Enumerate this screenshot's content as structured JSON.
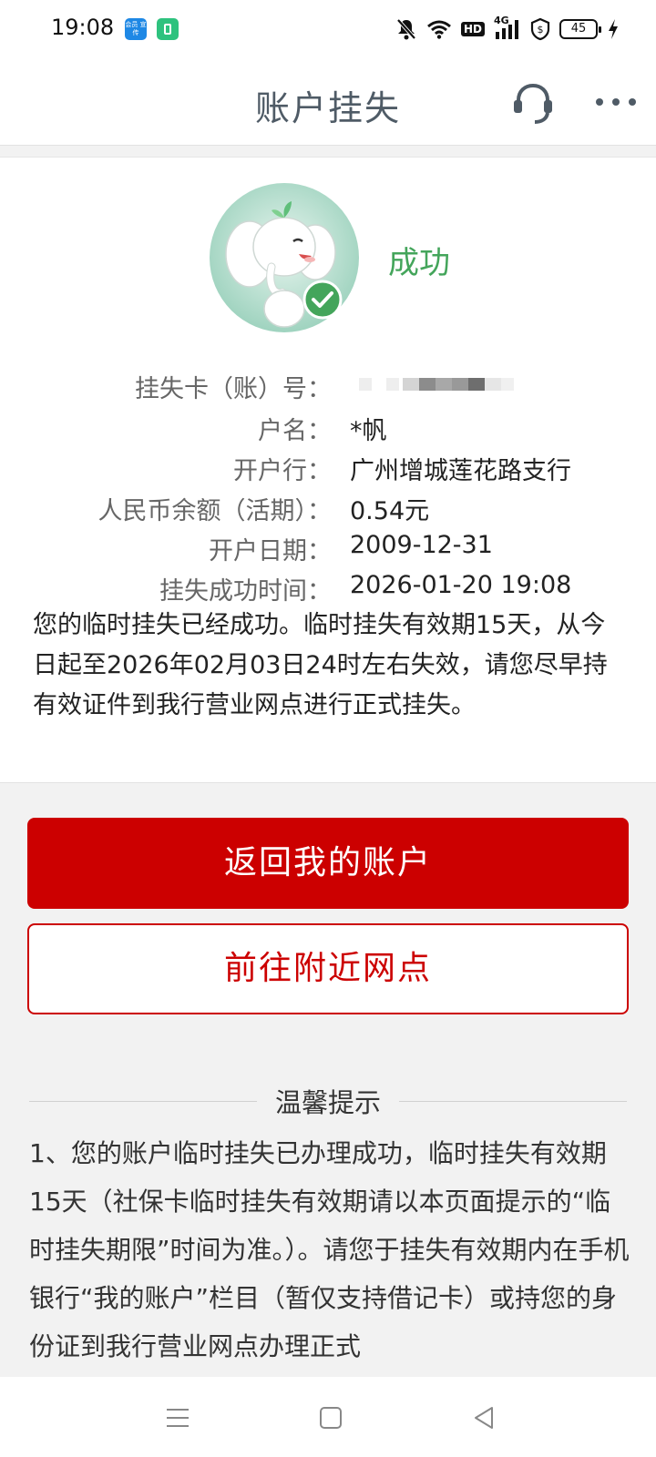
{
  "status_bar": {
    "time": "19:08",
    "app_icon_1_text": "会员 宣传",
    "icons": [
      "mute-icon",
      "wifi-icon",
      "hd-icon",
      "signal-4g-icon",
      "vpn-shield-icon",
      "battery-icon",
      "charging-icon"
    ],
    "network_label": "4G",
    "hd_label": "HD",
    "battery": "45"
  },
  "header": {
    "title": "账户挂失",
    "customer_service_icon": "headset-icon",
    "more_icon": "more-dots-icon"
  },
  "result": {
    "status": "成功",
    "mascot": "elephant-mascot-check",
    "accent_color": "#44a55b"
  },
  "details": [
    {
      "label": "挂失卡（账）号：",
      "value": ""
    },
    {
      "label": "户名：",
      "value": "*帆"
    },
    {
      "label": "开户行：",
      "value": "广州增城莲花路支行"
    },
    {
      "label": "人民币余额（活期）：",
      "value": "0.54元"
    },
    {
      "label": "开户日期：",
      "value": "2009-12-31"
    },
    {
      "label": "挂失成功时间：",
      "value": "2026-01-20 19:08"
    }
  ],
  "note": "您的临时挂失已经成功。临时挂失有效期15天，从今日起至2026年02月03日24时左右失效，请您尽早持有效证件到我行营业网点进行正式挂失。",
  "buttons": {
    "primary": "返回我的账户",
    "secondary": "前往附近网点",
    "brand_color": "#cc0000"
  },
  "tips": {
    "title": "温馨提示",
    "text": "1、您的账户临时挂失已办理成功，临时挂失有效期15天（社保卡临时挂失有效期请以本页面提示的“临时挂失期限”时间为准。）。请您于挂失有效期内在手机银行“我的账户”栏目（暂仅支持借记卡）或持您的身份证到我行营业网点办理正式"
  },
  "nav_bar": {
    "menu_icon": "menu-lines-icon",
    "home_icon": "home-square-icon",
    "back_icon": "back-triangle-icon"
  }
}
